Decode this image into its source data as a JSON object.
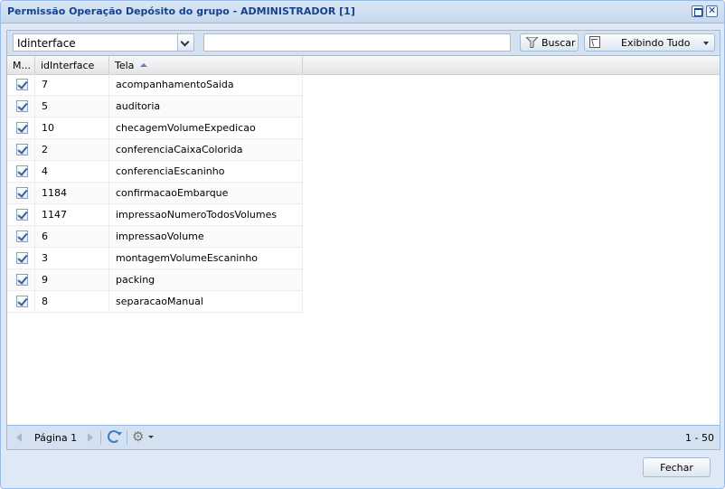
{
  "window": {
    "title": "Permissão Operação Depósito do grupo - ADMINISTRADOR [1]",
    "close_glyph": "✕"
  },
  "toolbar": {
    "field_select_value": "Idinterface",
    "search_value": "",
    "search_label": "Buscar",
    "display_label": "Exibindo Tudo"
  },
  "grid": {
    "columns": [
      "M...",
      "idInterface",
      "Tela"
    ],
    "sorted_column": "Tela",
    "rows": [
      {
        "checked": true,
        "id": "7",
        "tela": "acompanhamentoSaida"
      },
      {
        "checked": true,
        "id": "5",
        "tela": "auditoria"
      },
      {
        "checked": true,
        "id": "10",
        "tela": "checagemVolumeExpedicao"
      },
      {
        "checked": true,
        "id": "2",
        "tela": "conferenciaCaixaColorida"
      },
      {
        "checked": true,
        "id": "4",
        "tela": "conferenciaEscaninho"
      },
      {
        "checked": true,
        "id": "1184",
        "tela": "confirmacaoEmbarque"
      },
      {
        "checked": true,
        "id": "1147",
        "tela": "impressaoNumeroTodosVolumes"
      },
      {
        "checked": true,
        "id": "6",
        "tela": "impressaoVolume"
      },
      {
        "checked": true,
        "id": "3",
        "tela": "montagemVolumeEscaninho"
      },
      {
        "checked": true,
        "id": "9",
        "tela": "packing"
      },
      {
        "checked": true,
        "id": "8",
        "tela": "separacaoManual"
      }
    ]
  },
  "pager": {
    "page_label": "Página 1",
    "count": "1 - 50",
    "gear_glyph": "⚙"
  },
  "footer": {
    "close_label": "Fechar"
  }
}
